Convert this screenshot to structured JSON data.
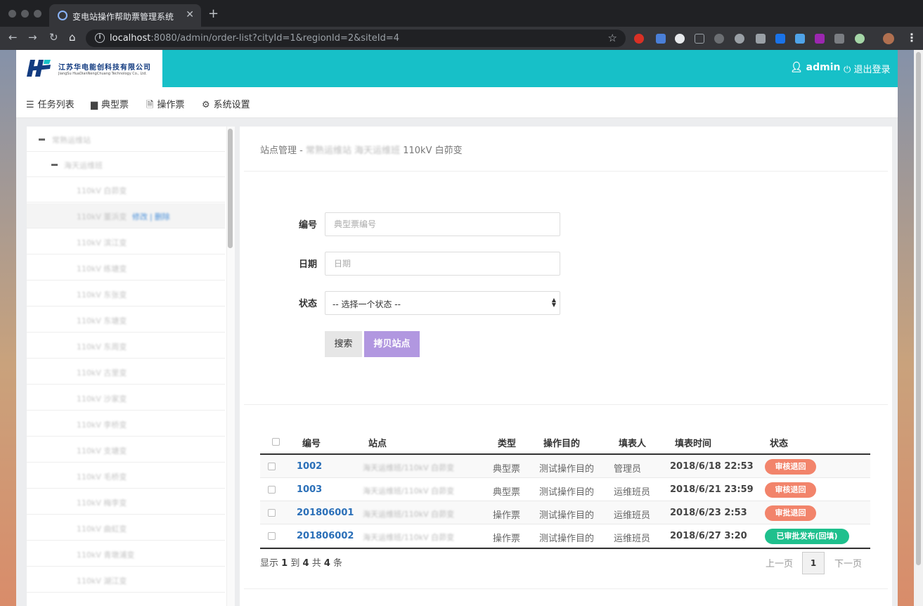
{
  "browser": {
    "tab_title": "变电站操作帮助票管理系统",
    "url_host": "localhost",
    "url_rest": ":8080/admin/order-list?cityId=1&regionId=2&siteId=4"
  },
  "header": {
    "brand_cn": "江苏华电能创科技有限公司",
    "brand_en": "JiangSu HuaDianNengChuang Technology Co., Ltd.",
    "user": "admin",
    "logout": "退出登录"
  },
  "topnav": {
    "items": [
      {
        "label": "任务列表",
        "icon": "list-icon"
      },
      {
        "label": "典型票",
        "icon": "file-icon"
      },
      {
        "label": "操作票",
        "icon": "file-text-icon"
      },
      {
        "label": "系统设置",
        "icon": "gear-icon"
      }
    ]
  },
  "sidebar": {
    "level1": "常熟运维站",
    "level2": "海天运维班",
    "sites": [
      "110kV 白茆变",
      "110kV 董浜变",
      "110kV 滨江变",
      "110kV 练塘变",
      "110kV 东张变",
      "110kV 东塘变",
      "110kV 东周变",
      "110kV 古里变",
      "110kV 沙家变",
      "110kV 李桥变",
      "110kV 支塘变",
      "110kV 毛桥变",
      "110kV 梅李变",
      "110kV 曲虹变",
      "110kV 青墩浦变",
      "110kV 湖江变"
    ],
    "active_actions": {
      "edit": "修改",
      "sep": "|",
      "delete": "删除"
    }
  },
  "main": {
    "breadcrumb_prefix": "站点管理 - ",
    "breadcrumb_blur": "常熟运维站 海天运维班 ",
    "breadcrumb_site": "110kV 白茆变",
    "form": {
      "number_label": "编号",
      "number_placeholder": "典型票编号",
      "date_label": "日期",
      "date_placeholder": "日期",
      "status_label": "状态",
      "status_value": "-- 选择一个状态 --",
      "search_button": "搜索",
      "copy_button": "拷贝站点"
    },
    "table": {
      "headers": [
        "编号",
        "站点",
        "类型",
        "操作目的",
        "填表人",
        "填表时间",
        "状态"
      ],
      "rows": [
        {
          "no": "1002",
          "site": "海天运维班/110kV 白茆变",
          "type": "典型票",
          "purpose": "测试操作目的",
          "filler": "管理员",
          "time": "2018/6/18 22:53",
          "status": "审核退回",
          "status_color": "#f2846b"
        },
        {
          "no": "1003",
          "site": "海天运维班/110kV 白茆变",
          "type": "典型票",
          "purpose": "测试操作目的",
          "filler": "运维班员",
          "time": "2018/6/21 23:59",
          "status": "审核退回",
          "status_color": "#f2846b"
        },
        {
          "no": "201806001",
          "site": "海天运维班/110kV 白茆变",
          "type": "操作票",
          "purpose": "测试操作目的",
          "filler": "运维班员",
          "time": "2018/6/23 2:53",
          "status": "审批退回",
          "status_color": "#f2846b"
        },
        {
          "no": "201806002",
          "site": "海天运维班/110kV 白茆变",
          "type": "操作票",
          "purpose": "测试操作目的",
          "filler": "运维班员",
          "time": "2018/6/27 3:20",
          "status": "已审批发布(回填)",
          "status_color": "#1fc08d"
        }
      ]
    },
    "footer": {
      "show": "显示",
      "from": "1",
      "to_word": "到",
      "to": "4",
      "total_word": "共",
      "total": "4",
      "unit": "条",
      "prev": "上一页",
      "current_page": "1",
      "next": "下一页"
    }
  }
}
